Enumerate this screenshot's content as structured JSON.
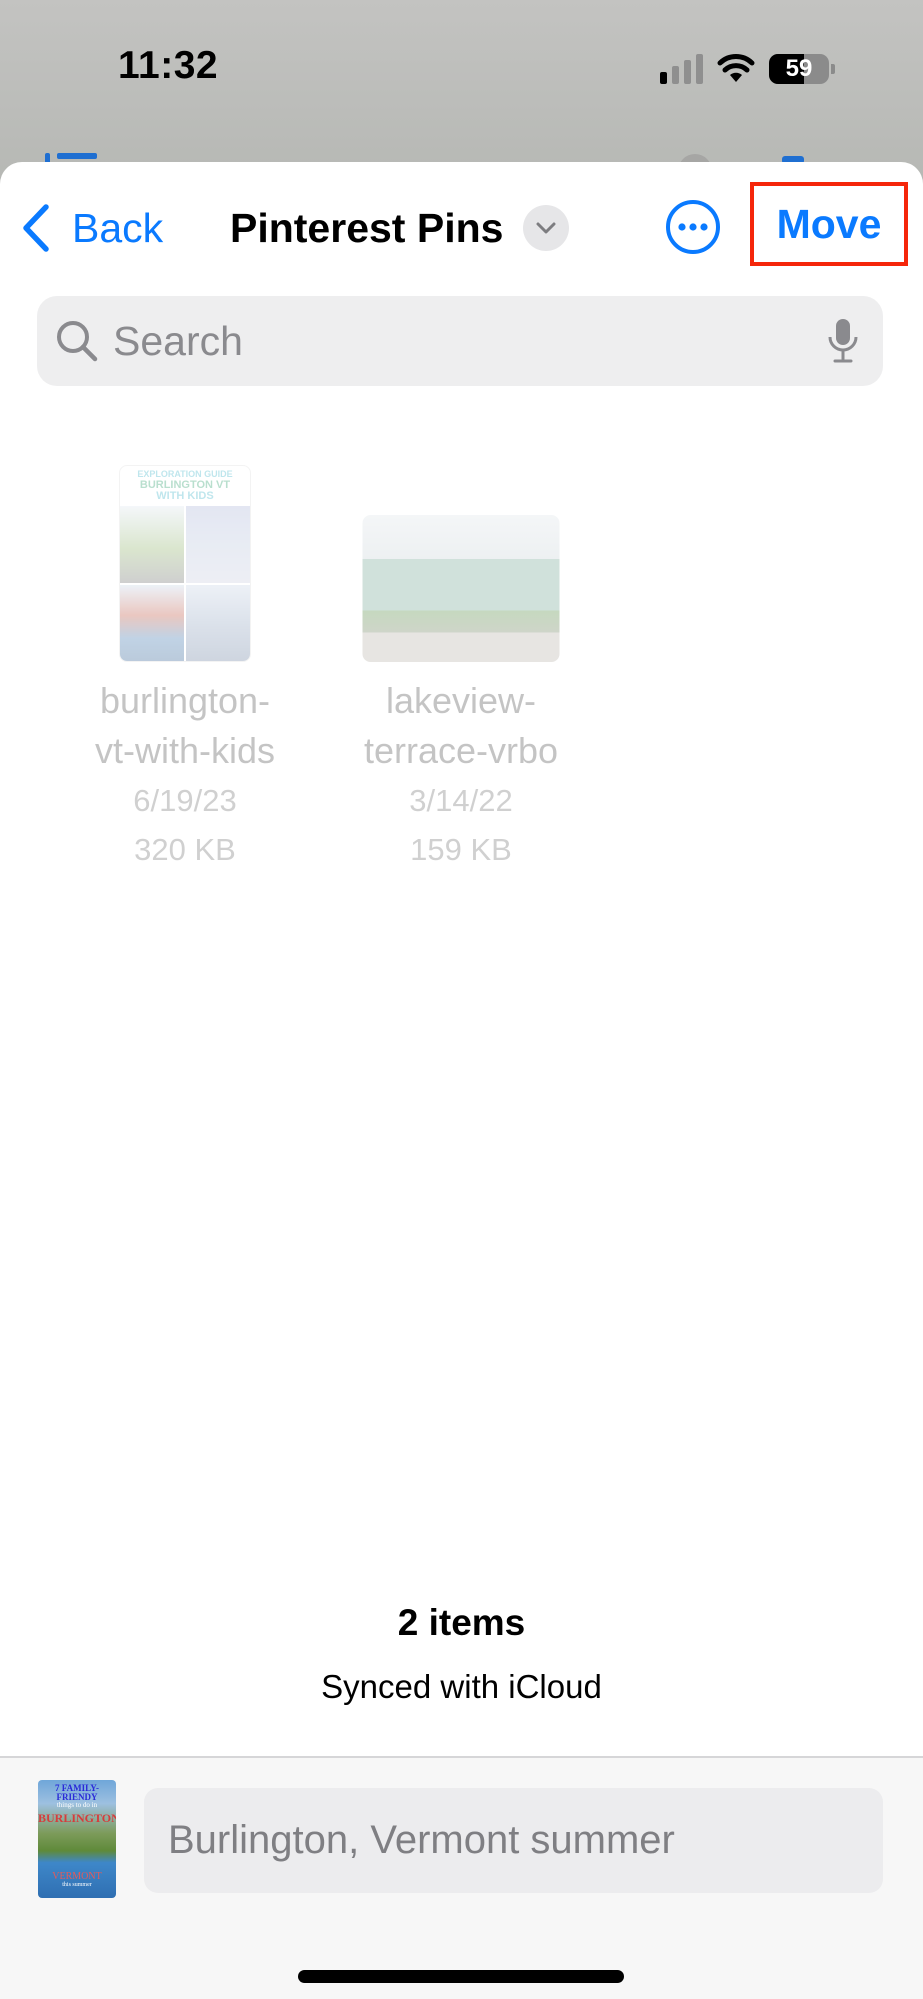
{
  "status_bar": {
    "time": "11:32",
    "battery_percent": "59",
    "battery_level": 0.59,
    "signal_bars_active": 1,
    "signal_bars_total": 4,
    "wifi": "wifi-icon"
  },
  "nav": {
    "back_label": "Back",
    "title": "Pinterest Pins",
    "title_menu_icon": "chevron-down-icon",
    "more_icon": "ellipsis-circle-icon",
    "move_label": "Move",
    "highlight_color": "#f5260a",
    "accent_color": "#0a7aff"
  },
  "search": {
    "placeholder": "Search",
    "value": "",
    "icon": "search-icon",
    "mic_icon": "microphone-icon"
  },
  "files": [
    {
      "name_line1": "burlington-",
      "name_line2": "vt-with-kids",
      "date": "6/19/23",
      "size": "320 KB",
      "thumb_text": [
        "EXPLORATION GUIDE",
        "BURLINGTON VT",
        "WITH KIDS"
      ]
    },
    {
      "name_line1": "lakeview-",
      "name_line2": "terrace-vrbo",
      "date": "3/14/22",
      "size": "159 KB"
    }
  ],
  "footer": {
    "item_count": "2 items",
    "sync_status": "Synced with iCloud"
  },
  "share_panel": {
    "pin_thumb_text": [
      "7 FAMILY-FRIENDY",
      "things to do in",
      "BURLINGTON",
      "VERMONT",
      "this summer"
    ],
    "caption_value": "Burlington, Vermont summer"
  }
}
